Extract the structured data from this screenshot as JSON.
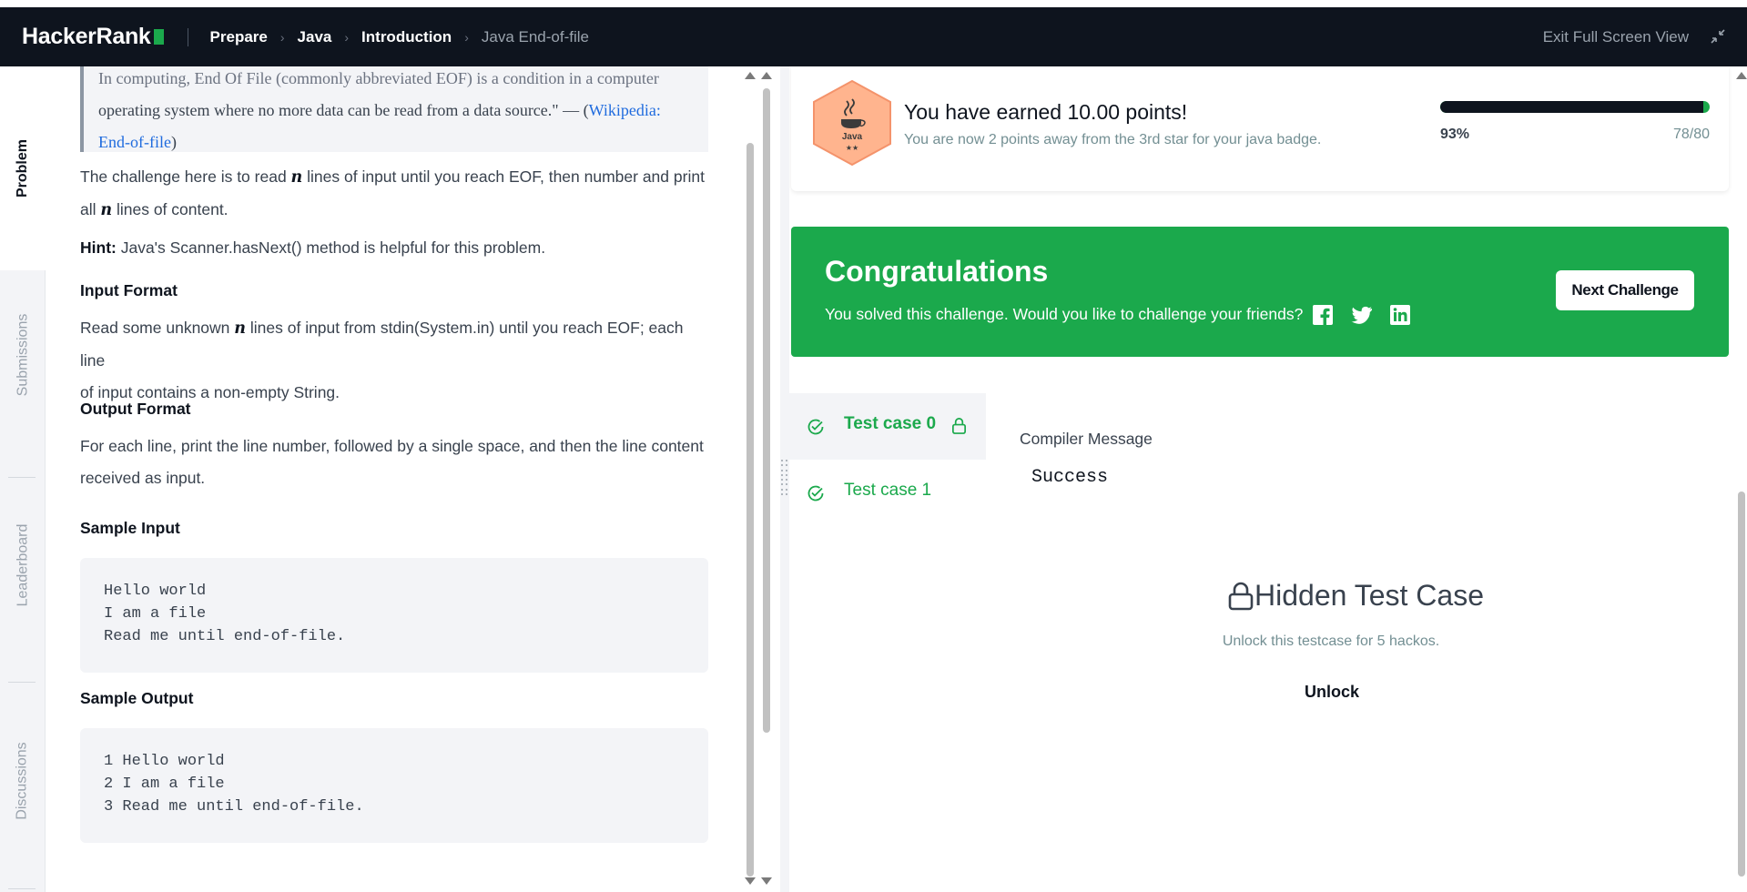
{
  "header": {
    "logo": "HackerRank",
    "breadcrumbs": [
      "Prepare",
      "Java",
      "Introduction"
    ],
    "current": "Java End-of-file",
    "exit_fullscreen": "Exit Full Screen View"
  },
  "tabs": [
    "Problem",
    "Submissions",
    "Leaderboard",
    "Discussions"
  ],
  "problem": {
    "quote_line1": "In computing, End Of File (commonly abbreviated EOF) is a condition in a computer",
    "quote_line2": "operating system where no more data can be read from a data source.\" — (",
    "quote_link": "Wikipedia:",
    "quote_link2": "End-of-file",
    "quote_close": ")",
    "challenge_a": "The challenge here is to read ",
    "challenge_b": " lines of input until you reach EOF, then number and print",
    "challenge_c": "all ",
    "challenge_d": " lines of content.",
    "var_n": "n",
    "hint_label": "Hint:",
    "hint_text": " Java's Scanner.hasNext() method is helpful for this problem.",
    "input_format_heading": "Input Format",
    "input_a": "Read some unknown ",
    "input_b": " lines of input from stdin(System.in) until you reach EOF; each line",
    "input_c": "of input contains a non-empty String.",
    "output_format_heading": "Output Format",
    "output_a": "For each line, print the line number, followed by a single space, and then the line content",
    "output_b": "received as input.",
    "sample_input_heading": "Sample Input",
    "sample_input": "Hello world\nI am a file\nRead me until end-of-file.",
    "sample_output_heading": "Sample Output",
    "sample_output": "1 Hello world\n2 I am a file\n3 Read me until end-of-file."
  },
  "points": {
    "badge_label": "Java",
    "badge_stars": "★★",
    "earned": "You have earned 10.00 points!",
    "away": "You are now 2 points away from the 3rd star for your java badge.",
    "progress_fraction": 0.975,
    "percent": "93%",
    "score": "78/80"
  },
  "congrats": {
    "title": "Congratulations",
    "message": "You solved this challenge. Would you like to challenge your friends?",
    "next_button": "Next Challenge",
    "bg_color": "#1ba94c"
  },
  "test_cases": [
    {
      "label": "Test case 0",
      "locked": true
    },
    {
      "label": "Test case 1",
      "locked": false
    }
  ],
  "result": {
    "compiler_label": "Compiler Message",
    "compiler_value": "Success",
    "hidden_title": "Hidden Test Case",
    "hidden_sub": "Unlock this testcase for 5 hackos.",
    "unlock": "Unlock"
  },
  "icons": [
    "collapse-icon",
    "java-badge-icon",
    "facebook-icon",
    "twitter-icon",
    "linkedin-icon",
    "check-circle-icon",
    "lock-icon"
  ]
}
